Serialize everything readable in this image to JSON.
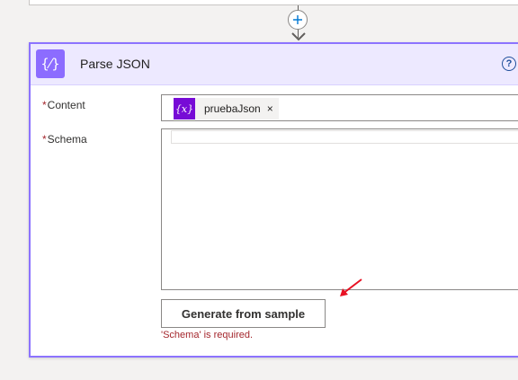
{
  "card": {
    "title": "Parse JSON",
    "action_icon": "{⁄}",
    "help_label": "?"
  },
  "connector": {
    "add_icon": "plus-icon"
  },
  "fields": {
    "required_marker": "*",
    "content_label": "Content",
    "schema_label": "Schema"
  },
  "content_token": {
    "icon_text": "{x}",
    "label": "pruebaJson",
    "remove": "×"
  },
  "schema": {
    "value": ""
  },
  "actions": {
    "generate_label": "Generate from sample"
  },
  "validation": {
    "error": "'Schema' is required."
  },
  "colors": {
    "card_border": "#8c73ff",
    "header_bg": "#ede9ff",
    "action_icon_bg": "#8c6cff",
    "token_icon_bg": "#770bd6",
    "error": "#a4262c",
    "annotation_arrow": "#e81123"
  }
}
